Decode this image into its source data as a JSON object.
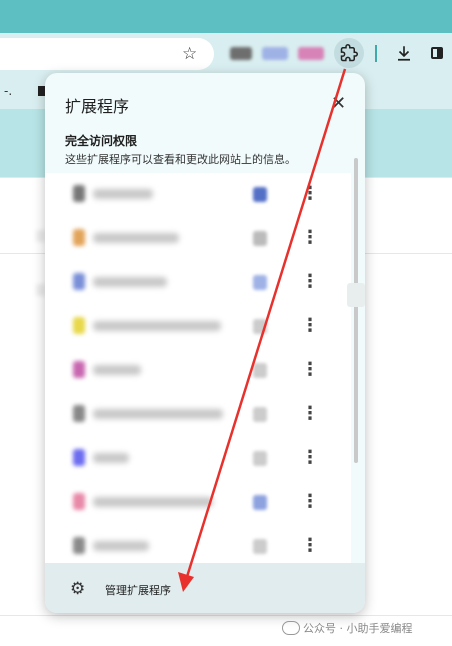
{
  "browser": {
    "bookmark_text": "-.",
    "icons": [
      "star-icon",
      "puzzle-icon",
      "download-icon",
      "side-panel-icon"
    ]
  },
  "popup": {
    "title": "扩展程序",
    "close_glyph": "✕",
    "section_title": "完全访问权限",
    "section_desc": "这些扩展程序可以查看和更改此网站上的信息。",
    "extensions": [
      {
        "menu": "⋮",
        "icon_color": "#777777",
        "pin_color": "#5470c6"
      },
      {
        "menu": "⋮",
        "icon_color": "#e2a45a",
        "pin_color": "#bbbbbb"
      },
      {
        "menu": "⋮",
        "icon_color": "#7a8fd8",
        "pin_color": "#9fb2e6"
      },
      {
        "menu": "⋮",
        "icon_color": "#e8d84a",
        "pin_color": "#cccccc"
      },
      {
        "menu": "⋮",
        "icon_color": "#c867b0",
        "pin_color": "#cccccc"
      },
      {
        "menu": "⋮",
        "icon_color": "#888888",
        "pin_color": "#cccccc"
      },
      {
        "menu": "⋮",
        "icon_color": "#6d6df0",
        "pin_color": "#cccccc"
      },
      {
        "menu": "⋮",
        "icon_color": "#e889a8",
        "pin_color": "#8ea2e0"
      },
      {
        "menu": "⋮",
        "icon_color": "#8a8a8a",
        "pin_color": "#cccccc"
      }
    ],
    "manage_label": "管理扩展程序"
  },
  "watermark": "公众号 · 小助手爱编程",
  "colors": {
    "accent_teal": "#5dbfc2",
    "arrow_red": "#e8312c"
  }
}
